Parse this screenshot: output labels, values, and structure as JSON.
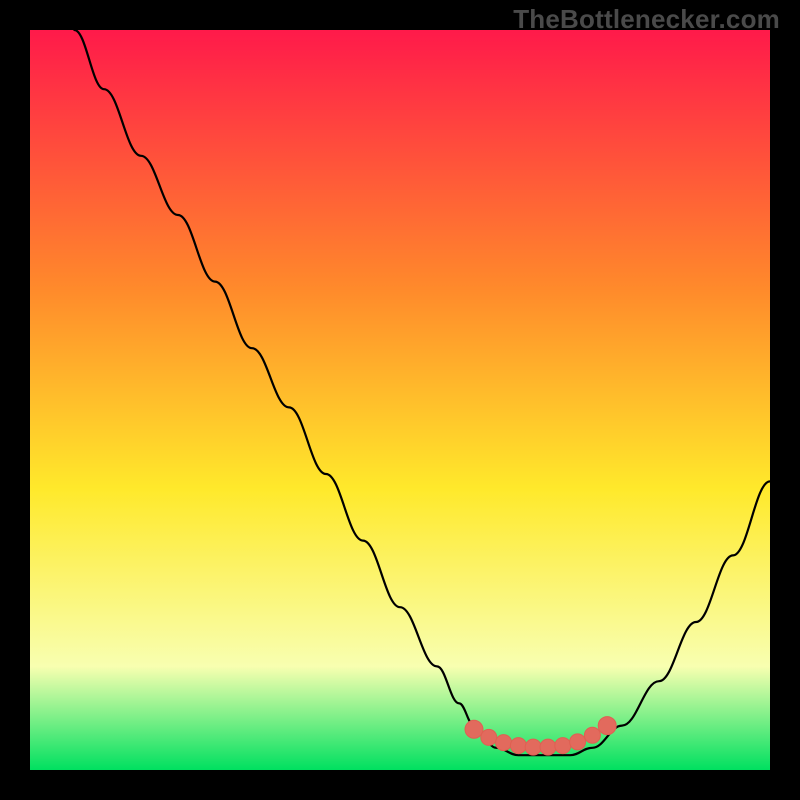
{
  "brand": "TheBottlenecker.com",
  "colors": {
    "frame": "#000000",
    "gradient_top": "#ff1a4a",
    "gradient_mid_upper": "#ff8a2b",
    "gradient_mid": "#ffe92b",
    "gradient_low": "#f8ffb0",
    "gradient_bottom": "#00e060",
    "curve": "#000000",
    "marker": "#e26a5d",
    "marker_stroke": "#df6052"
  },
  "chart_data": {
    "type": "line",
    "title": "",
    "xlabel": "",
    "ylabel": "",
    "xlim": [
      0,
      100
    ],
    "ylim": [
      0,
      100
    ],
    "series": [
      {
        "name": "bottleneck-curve",
        "x": [
          6,
          10,
          15,
          20,
          25,
          30,
          35,
          40,
          45,
          50,
          55,
          58,
          60,
          63,
          66,
          70,
          73,
          76,
          80,
          85,
          90,
          95,
          100
        ],
        "y": [
          100,
          92,
          83,
          75,
          66,
          57,
          49,
          40,
          31,
          22,
          14,
          9,
          6,
          3,
          2,
          2,
          2,
          3,
          6,
          12,
          20,
          29,
          39
        ]
      }
    ],
    "markers": {
      "name": "highlight-range",
      "points": [
        {
          "x": 60,
          "y": 5.5
        },
        {
          "x": 62,
          "y": 4.4
        },
        {
          "x": 64,
          "y": 3.7
        },
        {
          "x": 66,
          "y": 3.3
        },
        {
          "x": 68,
          "y": 3.1
        },
        {
          "x": 70,
          "y": 3.1
        },
        {
          "x": 72,
          "y": 3.3
        },
        {
          "x": 74,
          "y": 3.8
        },
        {
          "x": 76,
          "y": 4.7
        },
        {
          "x": 78,
          "y": 6.0
        }
      ]
    }
  }
}
